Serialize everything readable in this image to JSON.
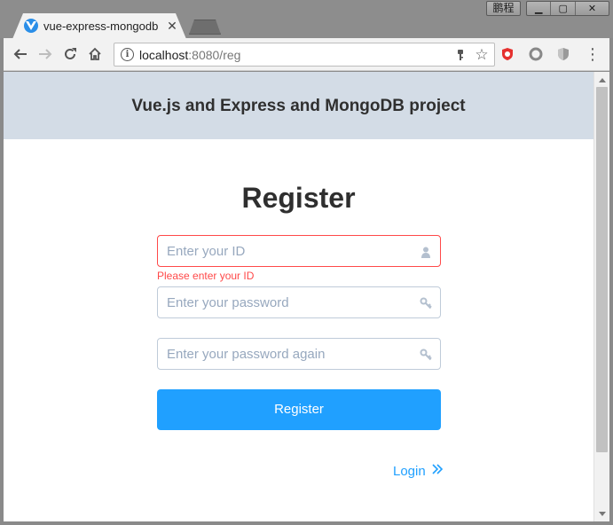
{
  "window": {
    "user_label": "鹏程",
    "minimize_glyph": "▁",
    "maximize_glyph": "▢",
    "close_glyph": "✕"
  },
  "tab": {
    "title": "vue-express-mongodb",
    "favicon": "vue-logo-icon",
    "close_glyph": "✕"
  },
  "toolbar": {
    "url_host": "localhost",
    "url_rest": ":8080/reg",
    "info_glyph": "i",
    "star_glyph": "☆",
    "menu_glyph": "⋮"
  },
  "page": {
    "header_title": "Vue.js and Express and MongoDB project",
    "heading": "Register",
    "id_field": {
      "value": "",
      "placeholder": "Enter your ID",
      "icon": "user-icon"
    },
    "id_error": "Please enter your ID",
    "password_field": {
      "value": "",
      "placeholder": "Enter your password",
      "icon": "key-icon"
    },
    "password_again_field": {
      "value": "",
      "placeholder": "Enter your password again",
      "icon": "key-icon"
    },
    "register_button": "Register",
    "login_link": "Login",
    "login_icon": "double-chevron-right-icon"
  },
  "colors": {
    "header_bg": "#d3dce6",
    "accent": "#20a0ff",
    "error": "#ff4949",
    "input_border": "#bfcbd9",
    "placeholder": "#97a8be"
  }
}
